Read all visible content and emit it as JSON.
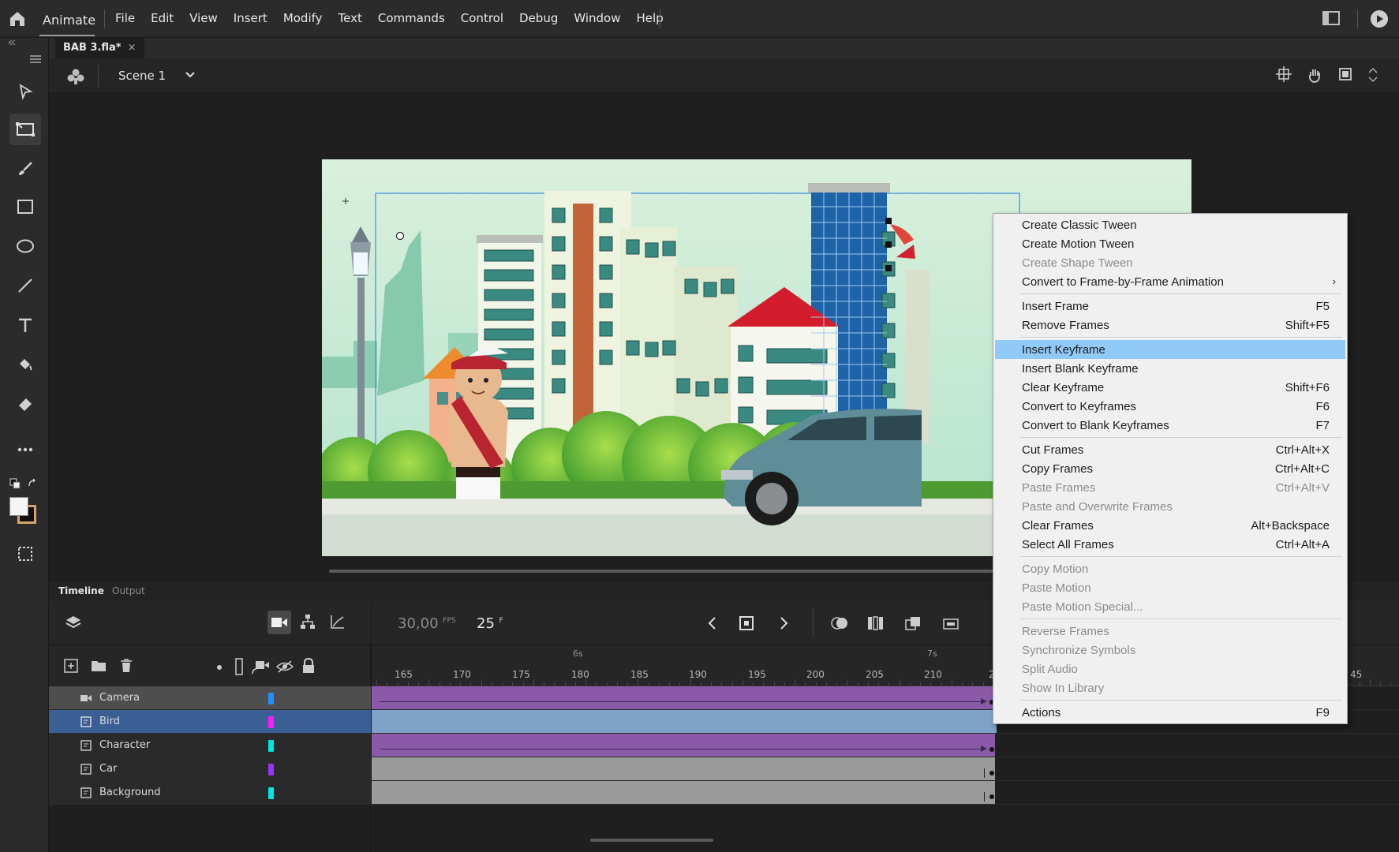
{
  "app": {
    "name": "Animate"
  },
  "menubar": {
    "items": [
      "File",
      "Edit",
      "View",
      "Insert",
      "Modify",
      "Text",
      "Commands",
      "Control",
      "Debug",
      "Window",
      "Help"
    ]
  },
  "document": {
    "tab_title": "BAB 3.fla*",
    "close_glyph": "×"
  },
  "scene": {
    "name": "Scene 1"
  },
  "panel_tabs": {
    "timeline": "Timeline",
    "output": "Output"
  },
  "timeline": {
    "fps": "30,00",
    "fps_unit": "FPS",
    "current_frame": "25",
    "frame_unit": "F",
    "seconds_labels": [
      "6s",
      "7s"
    ],
    "frame_labels": [
      "165",
      "170",
      "175",
      "180",
      "185",
      "190",
      "195",
      "200",
      "205",
      "210",
      "2",
      "45"
    ],
    "layers": [
      {
        "name": "Camera",
        "color": "#1e90ff",
        "type": "camera"
      },
      {
        "name": "Bird",
        "color": "#ff1aff",
        "type": "symbol",
        "selected": true
      },
      {
        "name": "Character",
        "color": "#00e5e5",
        "type": "symbol"
      },
      {
        "name": "Car",
        "color": "#9b30ff",
        "type": "symbol"
      },
      {
        "name": "Background",
        "color": "#00e5e5",
        "type": "symbol"
      }
    ]
  },
  "context_menu": {
    "items": [
      {
        "label": "Create Classic Tween",
        "shortcut": "",
        "disabled": false
      },
      {
        "label": "Create Motion Tween",
        "shortcut": "",
        "disabled": false
      },
      {
        "label": "Create Shape Tween",
        "shortcut": "",
        "disabled": true
      },
      {
        "label": "Convert to Frame-by-Frame Animation",
        "shortcut": "",
        "disabled": false,
        "submenu": true
      },
      {
        "label": "Insert Frame",
        "shortcut": "F5",
        "disabled": false
      },
      {
        "label": "Remove Frames",
        "shortcut": "Shift+F5",
        "disabled": false
      },
      {
        "label": "Insert Keyframe",
        "shortcut": "",
        "disabled": false,
        "highlighted": true
      },
      {
        "label": "Insert Blank Keyframe",
        "shortcut": "",
        "disabled": false
      },
      {
        "label": "Clear Keyframe",
        "shortcut": "Shift+F6",
        "disabled": false
      },
      {
        "label": "Convert to Keyframes",
        "shortcut": "F6",
        "disabled": false
      },
      {
        "label": "Convert to Blank Keyframes",
        "shortcut": "F7",
        "disabled": false
      },
      {
        "label": "Cut Frames",
        "shortcut": "Ctrl+Alt+X",
        "disabled": false
      },
      {
        "label": "Copy Frames",
        "shortcut": "Ctrl+Alt+C",
        "disabled": false
      },
      {
        "label": "Paste Frames",
        "shortcut": "Ctrl+Alt+V",
        "disabled": true
      },
      {
        "label": "Paste and Overwrite Frames",
        "shortcut": "",
        "disabled": true
      },
      {
        "label": "Clear Frames",
        "shortcut": "Alt+Backspace",
        "disabled": false
      },
      {
        "label": "Select All Frames",
        "shortcut": "Ctrl+Alt+A",
        "disabled": false
      },
      {
        "label": "Copy Motion",
        "shortcut": "",
        "disabled": true
      },
      {
        "label": "Paste Motion",
        "shortcut": "",
        "disabled": true
      },
      {
        "label": "Paste Motion Special...",
        "shortcut": "",
        "disabled": true
      },
      {
        "label": "Reverse Frames",
        "shortcut": "",
        "disabled": true
      },
      {
        "label": "Synchronize Symbols",
        "shortcut": "",
        "disabled": true
      },
      {
        "label": "Split Audio",
        "shortcut": "",
        "disabled": true
      },
      {
        "label": "Show In Library",
        "shortcut": "",
        "disabled": true
      },
      {
        "label": "Actions",
        "shortcut": "F9",
        "disabled": false
      }
    ]
  },
  "colors": {
    "accent_selection": "#3a5f94",
    "tween_purple": "#8a5aa8",
    "menu_highlight": "#91c9f7"
  }
}
